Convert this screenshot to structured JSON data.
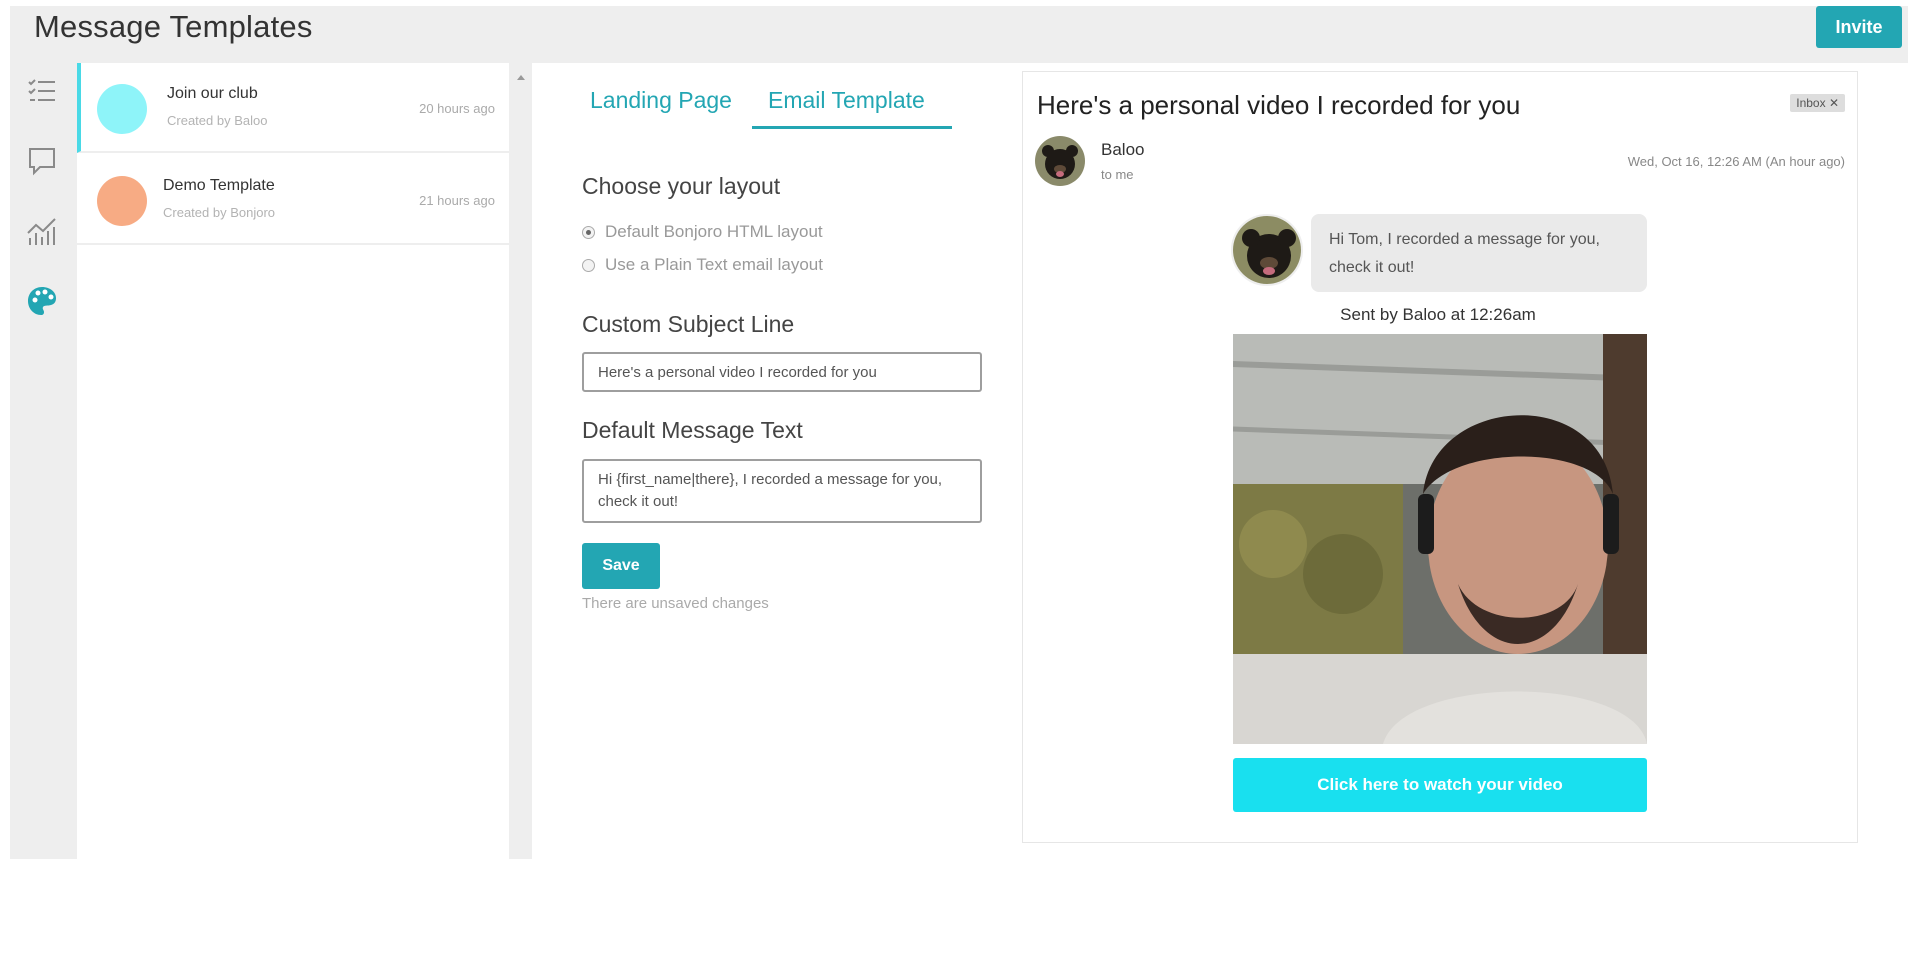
{
  "header": {
    "title": "Message Templates",
    "invite_label": "Invite"
  },
  "rail": {
    "icons": [
      "task-list-icon",
      "chat-bubble-icon",
      "analytics-chart-icon",
      "palette-icon"
    ],
    "active_color": "#23a6b3"
  },
  "templates": [
    {
      "name": "Join our club",
      "creator": "Created by Baloo",
      "time": "20 hours ago",
      "color": "#8ef4f9",
      "active": true
    },
    {
      "name": "Demo Template",
      "creator": "Created by Bonjoro",
      "time": "21 hours ago",
      "color": "#f7ab84",
      "active": false
    }
  ],
  "tabs": [
    {
      "label": "Landing Page",
      "active": false
    },
    {
      "label": "Email Template",
      "active": true
    }
  ],
  "form": {
    "layout_heading": "Choose your layout",
    "layout_options": [
      {
        "label": "Default Bonjoro HTML layout",
        "checked": true
      },
      {
        "label": "Use a Plain Text email layout",
        "checked": false
      }
    ],
    "subject_heading": "Custom Subject Line",
    "subject_value": "Here's a personal video I recorded for you",
    "message_heading": "Default Message Text",
    "message_value": "Hi {first_name|there}, I recorded a message for you, check it out!",
    "save_label": "Save",
    "unsaved_text": "There are unsaved changes"
  },
  "preview": {
    "subject": "Here's a personal video I recorded for you",
    "inbox_badge": "Inbox ✕",
    "sender": "Baloo",
    "to": "to me",
    "date": "Wed, Oct 16, 12:26 AM (An hour ago)",
    "bubble_text": "Hi Tom, I recorded a message for you, check it out!",
    "sent_by": "Sent by Baloo at 12:26am",
    "watch_label": "Click here to watch your video",
    "accent": "#19e0ef"
  }
}
